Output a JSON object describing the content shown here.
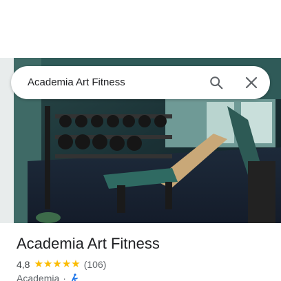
{
  "search": {
    "query": "Academia Art Fitness"
  },
  "place": {
    "name": "Academia Art Fitness",
    "rating": "4,8",
    "stars": 5,
    "reviews": "(106)",
    "category": "Academia",
    "separator": "·"
  },
  "icons": {
    "search": "search-icon",
    "close": "close-icon",
    "travel_mode": "walking-icon",
    "star": "star-icon"
  },
  "colors": {
    "star": "#fbbc04",
    "text_primary": "#202124",
    "text_secondary": "#5f6368",
    "walk_icon": "#1a73e8"
  }
}
